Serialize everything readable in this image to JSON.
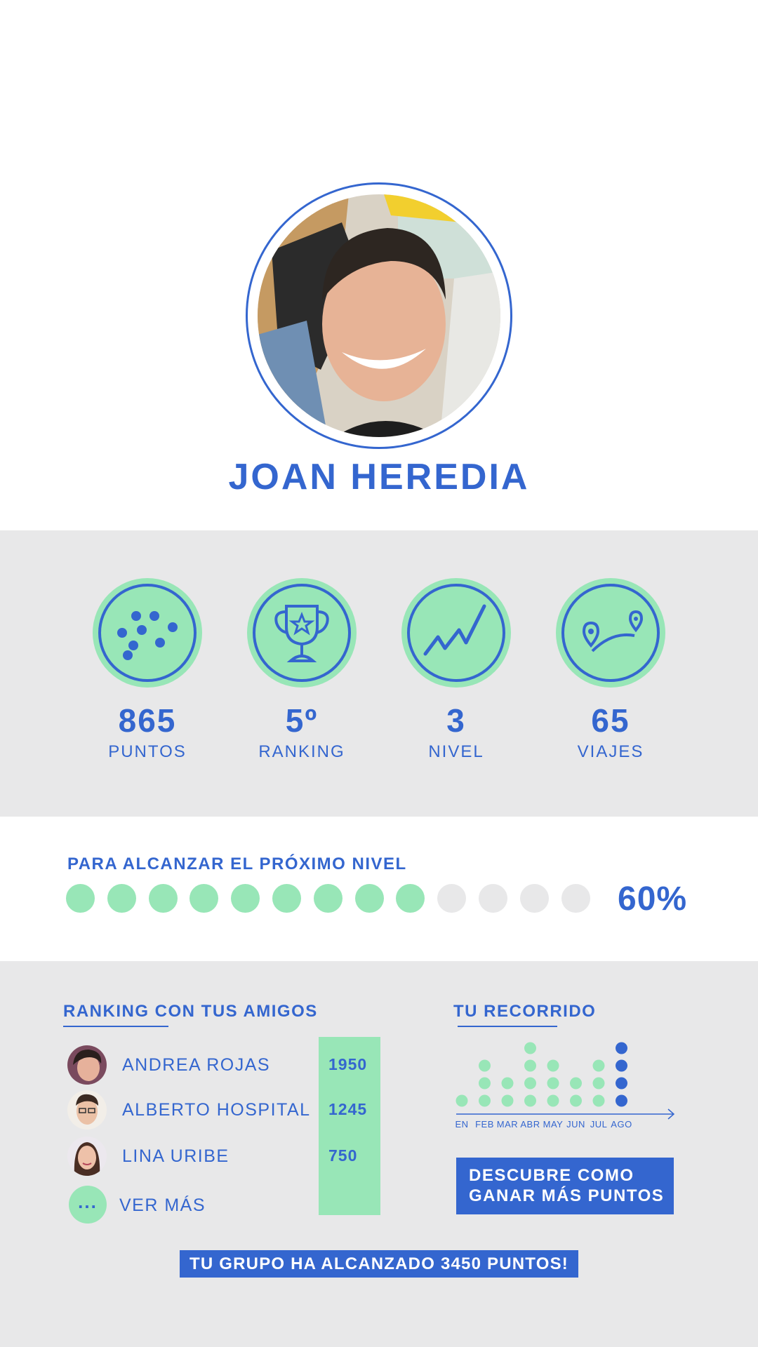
{
  "profile": {
    "name": "JOAN HEREDIA"
  },
  "stats": [
    {
      "value": "865",
      "label": "PUNTOS",
      "icon": "dots-icon"
    },
    {
      "value": "5º",
      "label": "RANKING",
      "icon": "trophy-icon"
    },
    {
      "value": "3",
      "label": "NIVEL",
      "icon": "trend-line-icon"
    },
    {
      "value": "65",
      "label": "VIAJES",
      "icon": "route-pins-icon"
    }
  ],
  "progress": {
    "title": "PARA ALCANZAR EL PRÓXIMO NIVEL",
    "percent_label": "60%",
    "filled_steps": 9,
    "total_steps": 13
  },
  "friends": {
    "title": "RANKING CON TUS AMIGOS",
    "rows": [
      {
        "name": "ANDREA ROJAS",
        "score": "1950"
      },
      {
        "name": "ALBERTO HOSPITAL",
        "score": "1245"
      },
      {
        "name": "LINA URIBE",
        "score": "750"
      }
    ],
    "see_more_icon": "...",
    "see_more_label": "VER MÁS"
  },
  "journey": {
    "title": "TU RECORRIDO",
    "months": [
      "EN",
      "FEB",
      "MAR",
      "ABR",
      "MAY",
      "JUN",
      "JUL",
      "AGO"
    ],
    "values": [
      1,
      3,
      2,
      4,
      3,
      2,
      3,
      4
    ],
    "highlight_month": "AGO"
  },
  "discover_button": {
    "line1": "DESCUBRE COMO",
    "line2": "GANAR MÁS PUNTOS"
  },
  "group_banner": "TU GRUPO HA ALCANZADO 3450 PUNTOS!",
  "colors": {
    "primary": "#3466cf",
    "accent_green": "#98e6b7",
    "band_gray": "#e8e8e9",
    "empty_dot": "#e8e8e9"
  }
}
